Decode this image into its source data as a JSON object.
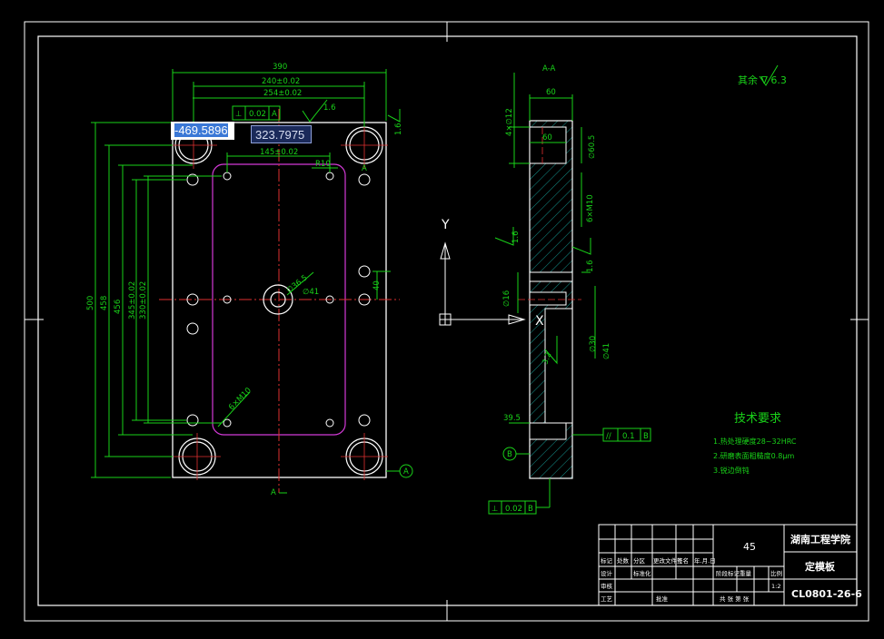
{
  "section_label": "A-A",
  "surface_roughness": "其余 ∇ 6.3",
  "coords": {
    "x": "-469.5896",
    "y": "323.7975"
  },
  "ucs": {
    "y": "Y",
    "x": "X"
  },
  "front_dims": {
    "width": "390",
    "w240": "240±0.02",
    "w254": "254±0.02",
    "w145": "145±0.02",
    "h500": "500",
    "h458": "458",
    "h456": "456",
    "h345": "345±0.02",
    "h330": "330±0.02",
    "r10": "R10",
    "phi": "∅36.5",
    "m41": "∅41",
    "h40": "40",
    "holes": "6×M10",
    "gd1": "0.02",
    "gd1_ref": "A",
    "rough_1_6": "1.6",
    "datum_a": "A",
    "section_mark": "A"
  },
  "side_dims": {
    "t60": "60",
    "t60b": "60",
    "d12": "4×∅12",
    "m10": "6×M10",
    "rough_16a": "1.6",
    "rough_16b": "1.6",
    "rough_32": "3.2",
    "d16": "∅16",
    "d41": "∅41",
    "d36": "∅30",
    "d59": "∅60.5",
    "d395": "39.5",
    "gd_par": "0.1",
    "gd_par_ref": "B",
    "gd_flat": "0.02",
    "gd_flat_ref": "B",
    "datum_b": "B"
  },
  "tech_req": {
    "title": "技术要求",
    "items": [
      "1.热处理硬度28~32HRC",
      "2.研磨表面粗糙度0.8μm",
      "3.锐边倒钝"
    ]
  },
  "title_block": {
    "material": "45",
    "school": "湖南工程学院",
    "part_name": "定模板",
    "drawing_no": "CL0801-26-6",
    "scale": "1:2",
    "row_labels": [
      "标记",
      "处数",
      "分区",
      "更改文件号",
      "签名",
      "年.月.日"
    ],
    "design": "设计",
    "std": "标准化",
    "review": "审核",
    "process": "工艺",
    "approve": "批准",
    "stage": "阶段标记",
    "weight": "重量",
    "ratio": "比例",
    "sheets": "共  张  第  张"
  }
}
